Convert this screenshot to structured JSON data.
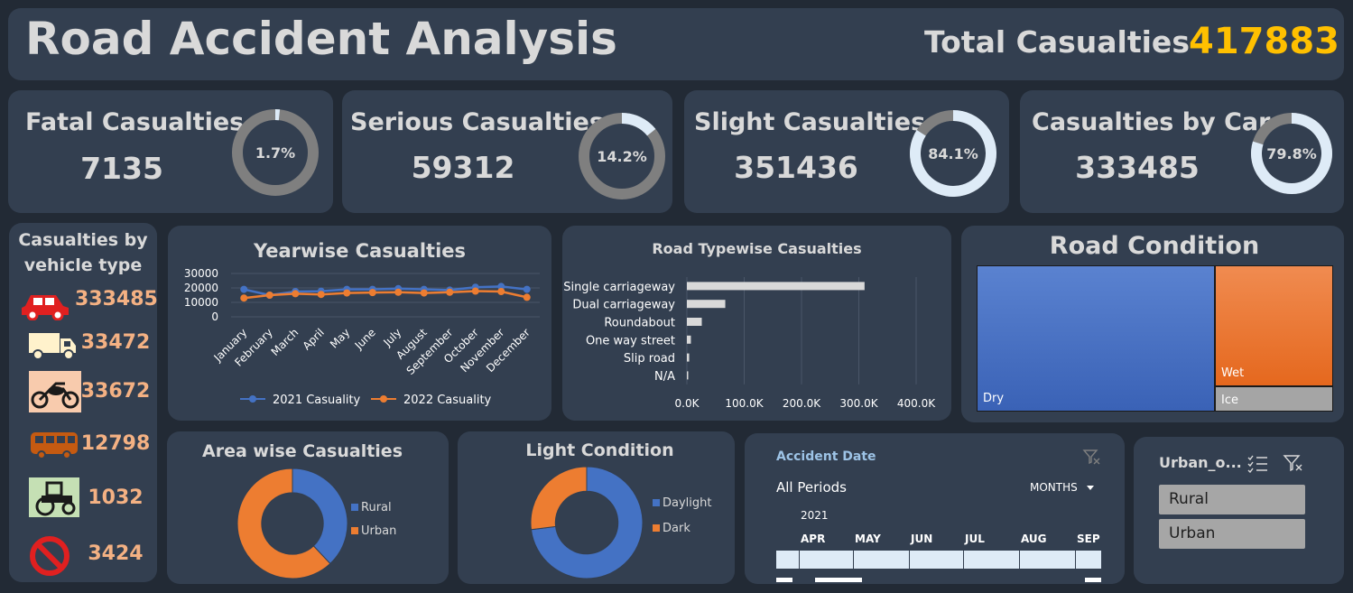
{
  "header": {
    "title": "Road Accident Analysis",
    "total_label": "Total Casualties",
    "total_value": "417883",
    "total_color": "#ffc000"
  },
  "kpis": [
    {
      "title": "Fatal Casualties",
      "value": "7135",
      "pct_label": "1.7%",
      "pct": 1.7
    },
    {
      "title": "Serious Casualties",
      "value": "59312",
      "pct_label": "14.2%",
      "pct": 14.2
    },
    {
      "title": "Slight Casualties",
      "value": "351436",
      "pct_label": "84.1%",
      "pct": 84.1
    },
    {
      "title": "Casualties by Car",
      "value": "333485",
      "pct_label": "79.8%",
      "pct": 79.8
    }
  ],
  "vehicle_panel": {
    "title_line1": "Casualties by",
    "title_line2": "vehicle type",
    "items": [
      {
        "icon": "car-icon",
        "value": "333485"
      },
      {
        "icon": "truck-icon",
        "value": "33472"
      },
      {
        "icon": "motorcycle-icon",
        "value": "33672"
      },
      {
        "icon": "bus-icon",
        "value": "12798"
      },
      {
        "icon": "tractor-icon",
        "value": "1032"
      },
      {
        "icon": "no-entry-icon",
        "value": "3424"
      }
    ]
  },
  "colors": {
    "panel": "#333f50",
    "background": "#222a35",
    "series_2021": "#4472c4",
    "series_2022": "#ed7d31",
    "accent_orange": "#f4b183",
    "donut_track": "#7f7f7f",
    "donut_fill": "#deebf7"
  },
  "chart_data": [
    {
      "type": "line",
      "title": "Yearwise Casualties",
      "categories": [
        "January",
        "February",
        "March",
        "April",
        "May",
        "June",
        "July",
        "August",
        "September",
        "October",
        "November",
        "December"
      ],
      "series": [
        {
          "name": "2021 Casuality",
          "values": [
            19000,
            15000,
            17500,
            17700,
            19000,
            19000,
            19500,
            19000,
            18500,
            20500,
            21000,
            19000
          ]
        },
        {
          "name": "2022 Casuality",
          "values": [
            13000,
            15000,
            16000,
            15500,
            16500,
            16800,
            17000,
            16500,
            17000,
            17800,
            17500,
            13500
          ]
        }
      ],
      "yticks": [
        "30000",
        "20000",
        "10000",
        "0"
      ],
      "ylim": [
        0,
        30000
      ],
      "grid": true,
      "legend": "bottom"
    },
    {
      "type": "bar",
      "title": "Road Typewise Casualties",
      "categories": [
        "Single carriageway",
        "Dual carriageway",
        "Roundabout",
        "One way street",
        "Slip road",
        "N/A"
      ],
      "values": [
        310000,
        67000,
        26000,
        7000,
        4000,
        1000
      ],
      "xticks": [
        "0.0K",
        "100.0K",
        "200.0K",
        "300.0K",
        "400.0K"
      ],
      "xlim": [
        0,
        400000
      ],
      "orientation": "horizontal",
      "grid": true
    },
    {
      "type": "heatmap",
      "title": "Road Condition",
      "items": [
        {
          "name": "Dry",
          "value": 0.7,
          "color": "#4472c4"
        },
        {
          "name": "Wet",
          "value": 0.26,
          "color": "#ed7d31"
        },
        {
          "name": "Ice",
          "value": 0.04,
          "color": "#a5a5a5"
        }
      ]
    },
    {
      "type": "pie",
      "title": "Area wise Casualties",
      "labels": [
        "Rural",
        "Urban"
      ],
      "values": [
        38,
        62
      ],
      "colors": [
        "#4472c4",
        "#ed7d31"
      ],
      "legend": "right"
    },
    {
      "type": "pie",
      "title": "Light Condition",
      "labels": [
        "Daylight",
        "Dark"
      ],
      "values": [
        73,
        27
      ],
      "colors": [
        "#4472c4",
        "#ed7d31"
      ],
      "legend": "right"
    }
  ],
  "timeline": {
    "title": "Accident Date",
    "period_label": "All Periods",
    "unit_label": "MONTHS",
    "year": "2021",
    "months": [
      "APR",
      "MAY",
      "JUN",
      "JUL",
      "AUG",
      "SEP"
    ]
  },
  "slicer": {
    "title": "Urban_o...",
    "items": [
      "Rural",
      "Urban"
    ]
  }
}
